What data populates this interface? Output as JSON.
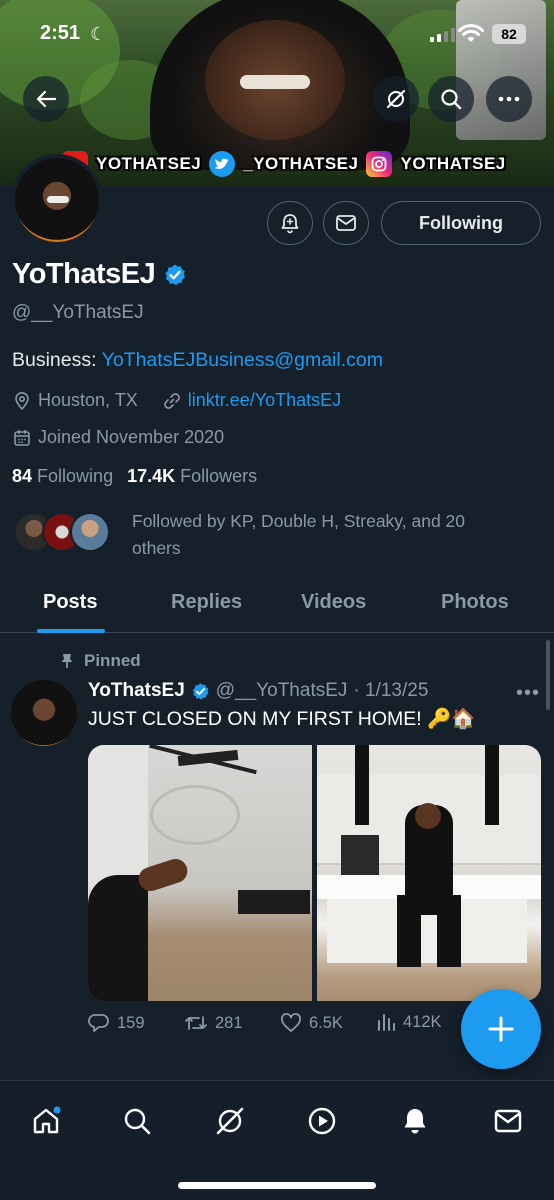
{
  "status_bar": {
    "time": "2:51",
    "battery": "82"
  },
  "banner": {
    "social_handles": [
      "YOTHATSEJ",
      "_YOTHATSEJ",
      "YOTHATSEJ"
    ],
    "icons": [
      "youtube-icon",
      "twitter-icon",
      "instagram-icon"
    ]
  },
  "profile": {
    "name": "YoThatsEJ",
    "handle": "@__YoThatsEJ",
    "bio_prefix": "Business: ",
    "bio_email": "YoThatsEJBusiness@gmail.com",
    "location": "Houston, TX",
    "website": "linktr.ee/YoThatsEJ",
    "joined": "Joined November 2020",
    "following_count": "84",
    "following_label": "Following",
    "followers_count": "17.4K",
    "followers_label": "Followers",
    "followed_by": "Followed by KP, Double H, Streaky, and 20 others",
    "follow_button": "Following"
  },
  "tabs": [
    {
      "label": "Posts",
      "active": true
    },
    {
      "label": "Replies",
      "active": false
    },
    {
      "label": "Videos",
      "active": false
    },
    {
      "label": "Photos",
      "active": false
    }
  ],
  "tweet": {
    "pinned_label": "Pinned",
    "author": "YoThatsEJ",
    "handle": "@__YoThatsEJ",
    "date": "· 1/13/25",
    "text": "JUST CLOSED ON MY FIRST HOME! 🔑🏠",
    "replies": "159",
    "retweets": "281",
    "likes": "6.5K",
    "views": "412K"
  },
  "colors": {
    "background": "#15202b",
    "accent": "#1d9bf0",
    "muted": "#8b98a5",
    "border": "#38444d"
  },
  "bottom_nav": [
    "home-icon",
    "search-icon",
    "grok-icon",
    "play-icon",
    "bell-icon",
    "mail-icon"
  ]
}
